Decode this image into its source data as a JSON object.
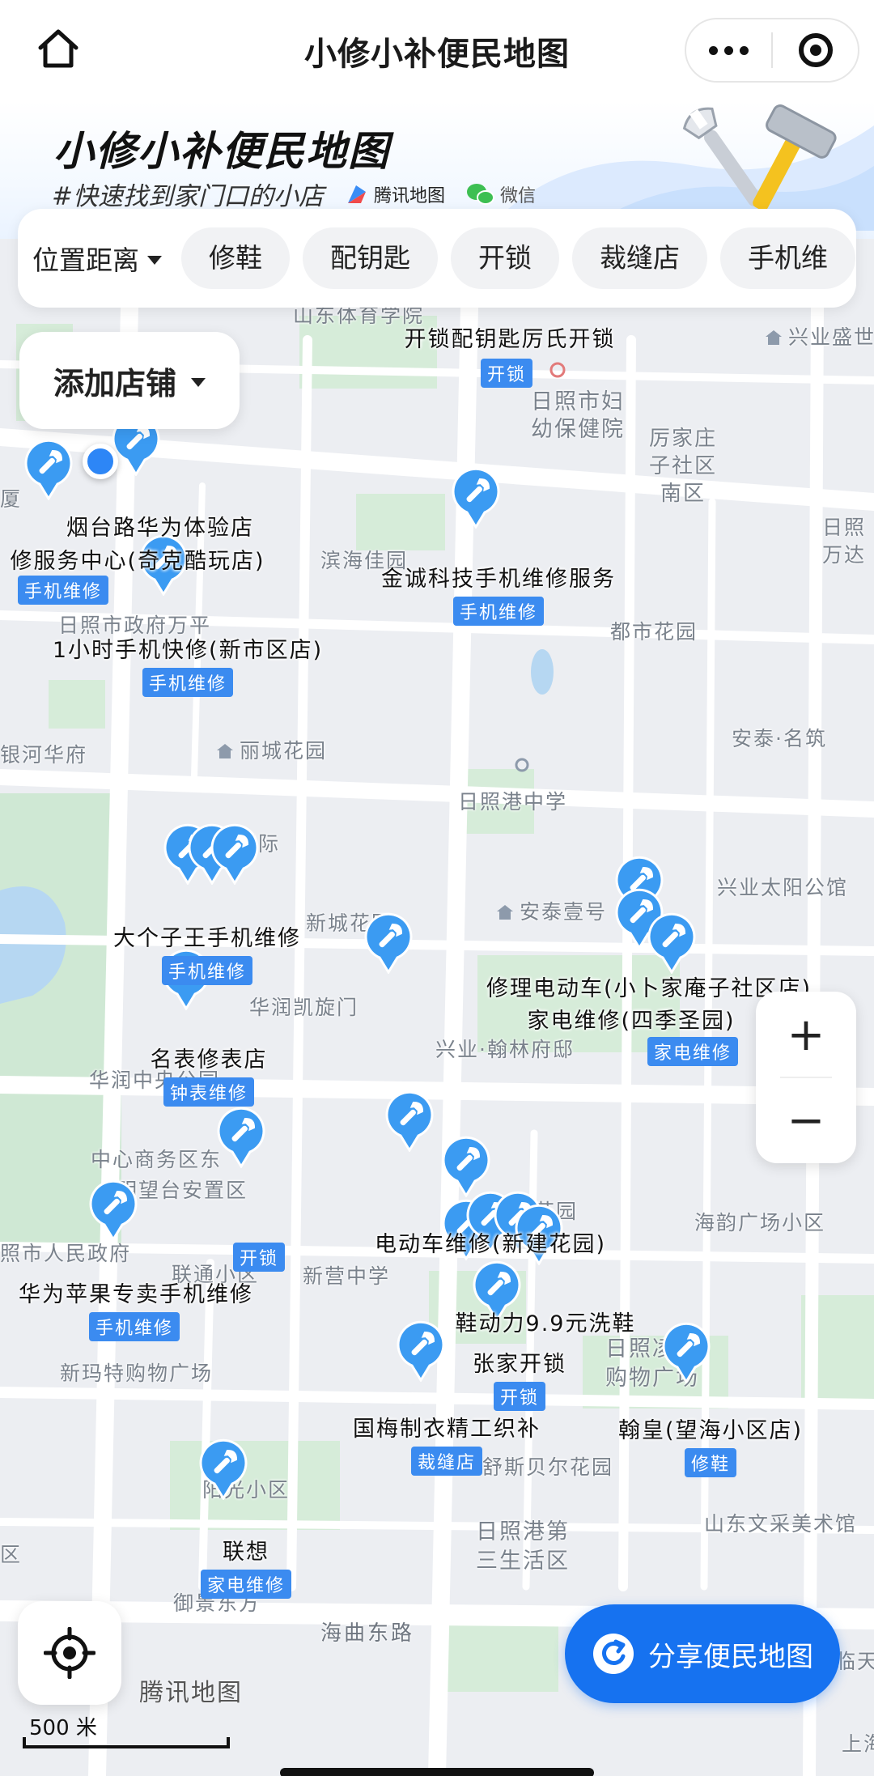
{
  "nav": {
    "title": "小修小补便民地图",
    "home_icon": "home-icon",
    "more_icon": "more-dots-icon",
    "miniapp_icon": "target-icon"
  },
  "hero": {
    "title": "小修小补便民地图",
    "slogan": "#快速找到家门口的小店",
    "brand_tencent": "腾讯地图",
    "brand_wechat": "微信"
  },
  "filters": {
    "sort_label": "位置距离",
    "chips": [
      "修鞋",
      "配钥匙",
      "开锁",
      "裁缝店",
      "手机维"
    ]
  },
  "add_store": {
    "label": "添加店铺"
  },
  "map": {
    "pois": [
      "山东体育学院",
      "兴业盛世",
      "日照市妇幼保健院",
      "厉家庄子社区南区",
      "厦",
      "都市花园",
      "滨海佳园",
      "日照万达",
      "日照市政府万平",
      "银河华府",
      "丽城花园",
      "安泰·名筑",
      "日照港中学",
      "大象国际",
      "兴业太阳公馆",
      "新城花园",
      "安泰壹号",
      "华润凯旋门",
      "兴业·翰林府邸",
      "华润中央公园",
      "中心商务区东",
      "明望台安置区",
      "海韵广场小区",
      "照市人民政府",
      "联通小区",
      "新营中学",
      "武建花园",
      "新玛特购物广场",
      "日照凌云购物广场",
      "舒斯贝尔花园",
      "阳光小区",
      "山东文采美术馆",
      "区",
      "日照港第三生活区",
      "御景东方",
      "上海",
      "临天"
    ],
    "roads": [
      "海曲东路"
    ],
    "stores": [
      {
        "name": "开锁配钥匙厉氏开锁",
        "tag": "开锁"
      },
      {
        "name": "烟台路华为体验店",
        "tag": ""
      },
      {
        "name": "修服务中心(奇克酷玩店)",
        "tag": "手机维修"
      },
      {
        "name": "金诚科技手机维修服务",
        "tag": "手机维修"
      },
      {
        "name": "1小时手机快修(新市区店)",
        "tag": "手机维修"
      },
      {
        "name": "大个子王手机维修",
        "tag": "手机维修"
      },
      {
        "name": "修理电动车(小卜家庵子社区店)",
        "tag": ""
      },
      {
        "name": "家电维修(四季圣园)",
        "tag": "家电维修"
      },
      {
        "name": "名表修表店",
        "tag": "钟表维修"
      },
      {
        "name": "电动车维修(新建花园)",
        "tag": ""
      },
      {
        "name": "华为苹果专卖手机维修",
        "tag": "手机维修"
      },
      {
        "name": "鞋动力9.9元洗鞋",
        "tag": ""
      },
      {
        "name": "张家开锁",
        "tag": "开锁"
      },
      {
        "name": "国梅制衣精工织补",
        "tag": "裁缝店"
      },
      {
        "name": "翰皇(望海小区店)",
        "tag": "修鞋"
      },
      {
        "name": "联想",
        "tag": "家电维修"
      }
    ],
    "extra_tags": [
      "开锁"
    ]
  },
  "controls": {
    "zoom_in": "+",
    "zoom_out": "−",
    "share_label": "分享便民地图",
    "map_logo": "腾讯地图",
    "scale_label": "500 米"
  },
  "colors": {
    "accent": "#1672f0",
    "pin": "#3b9bf2",
    "tag": "#3b8bf0",
    "map_bg": "#eceef2",
    "park": "#cfe8d4",
    "water": "#b6d7f2"
  }
}
